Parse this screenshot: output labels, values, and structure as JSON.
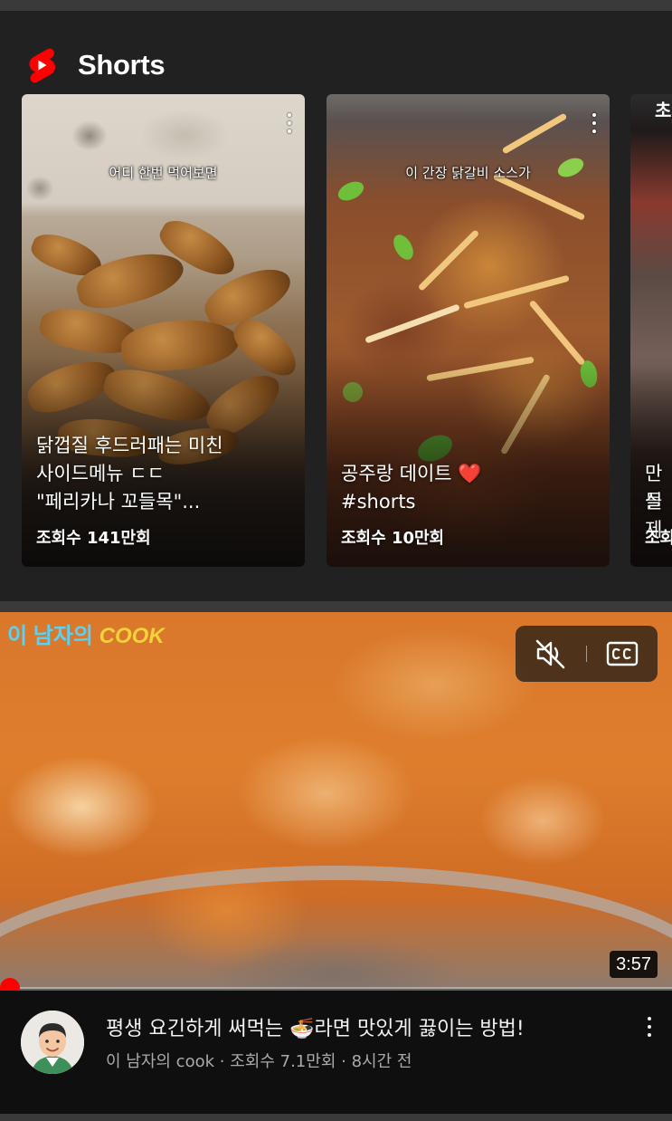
{
  "shelf": {
    "title": "Shorts",
    "cards": [
      {
        "overlay_caption": "어디 한번 먹어보면",
        "title_lines": [
          "닭껍질 후드러패는 미친",
          "사이드메뉴 ㄷㄷ",
          "\"페리카나 꼬들목\"..."
        ],
        "views": "조회수 141만회"
      },
      {
        "overlay_caption": "이 간장 닭갈비 소스가",
        "title_lines": [
          "공주랑 데이트 ❤️",
          "#shorts"
        ],
        "views": "조회수 10만회"
      },
      {
        "overlay_caption": "초",
        "title_lines": [
          "만들",
          "실제"
        ],
        "views": "조회"
      }
    ]
  },
  "video": {
    "watermark_part1": "이 남자의",
    "watermark_part2": "COOK",
    "duration": "3:57",
    "mute_icon": "volume-off-icon",
    "captions_icon": "closed-captions-icon",
    "progress_fraction": 0.01,
    "title": "평생 요긴하게 써먹는 🍜라면 맛있게 끓이는 방법!",
    "channel": "이 남자의 cook",
    "views": "조회수 7.1만회",
    "age": "8시간 전",
    "separator": "·"
  },
  "colors": {
    "background": "#0f0f0f",
    "shelf_background": "#212121",
    "divider": "#3a3a3a",
    "accent_red": "#ff0000",
    "secondary_text": "#aaaaaa"
  }
}
